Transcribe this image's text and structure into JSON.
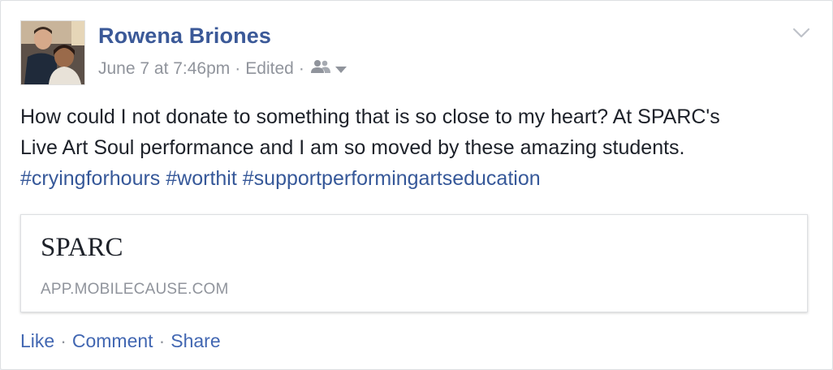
{
  "post": {
    "author": "Rowena Briones",
    "timestamp": "June 7 at 7:46pm",
    "edited_label": "Edited",
    "meta_separator": "·",
    "privacy_icon": "friends-icon",
    "menu_icon": "chevron-down-icon",
    "body": {
      "line1": "How could I not donate to something that is so close to my heart? At SPARC's",
      "line2": "Live Art Soul performance and I am so moved by these amazing students.",
      "hashtags": [
        "#cryingforhours",
        "#worthit",
        "#supportperformingartseducation"
      ]
    },
    "link_card": {
      "title": "SPARC",
      "domain": "APP.MOBILECAUSE.COM"
    },
    "actions": {
      "like": "Like",
      "comment": "Comment",
      "share": "Share",
      "separator": "·"
    }
  },
  "colors": {
    "link_blue": "#3b5998",
    "meta_gray": "#90949c",
    "text": "#1d2129"
  }
}
